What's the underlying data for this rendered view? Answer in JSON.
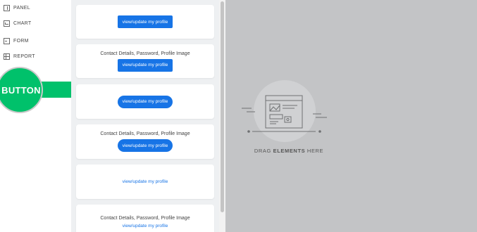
{
  "sidebar": {
    "items": [
      {
        "label": "PANEL",
        "icon": "panel-icon"
      },
      {
        "label": "CHART",
        "icon": "chart-icon"
      },
      {
        "label": "FORM",
        "icon": "form-icon"
      },
      {
        "label": "REPORT",
        "icon": "report-icon"
      }
    ],
    "active_label": "BUTTON",
    "active_color": "#00c16b"
  },
  "cards": [
    {
      "caption": "",
      "button": "view/update my profile",
      "style": "square"
    },
    {
      "caption": "Contact Details, Password, Profile Image",
      "button": "view/update my profile",
      "style": "square"
    },
    {
      "caption": "",
      "button": "view/update my profile",
      "style": "pill"
    },
    {
      "caption": "Contact Details, Password, Profile Image",
      "button": "view/update my profile",
      "style": "pill"
    },
    {
      "caption": "",
      "button": "view/update my profile",
      "style": "link"
    },
    {
      "caption": "Contact Details, Password, Profile Image",
      "button": "view/update my profile",
      "style": "link"
    }
  ],
  "canvas": {
    "drop_prefix": "DRAG",
    "drop_bold": "ELEMENTS",
    "drop_suffix": "HERE"
  },
  "colors": {
    "primary_button": "#1774e6",
    "canvas_bg": "#c3c4c6"
  }
}
